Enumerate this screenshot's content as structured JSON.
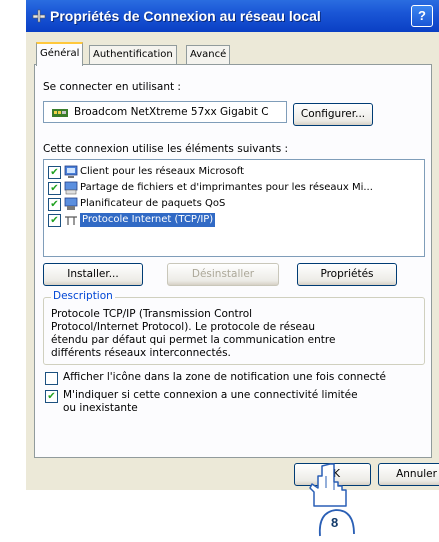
{
  "window": {
    "title": "Propriétés de Connexion au réseau local",
    "help_label": "?"
  },
  "tabs": [
    {
      "label": "Général"
    },
    {
      "label": "Authentification"
    },
    {
      "label": "Avancé"
    }
  ],
  "general": {
    "connect_using_label": "Se connecter en utilisant :",
    "adapter_name": "Broadcom NetXtreme 57xx Gigabit C",
    "configure_button": "Configurer...",
    "components_label": "Cette connexion utilise les éléments suivants :",
    "components": [
      {
        "label": "Client pour les réseaux Microsoft",
        "checked": true,
        "icon": "network-client-icon"
      },
      {
        "label": "Partage de fichiers et d'imprimantes pour les réseaux Mi...",
        "checked": true,
        "icon": "file-printer-sharing-icon"
      },
      {
        "label": "Planificateur de paquets QoS",
        "checked": true,
        "icon": "qos-scheduler-icon"
      },
      {
        "label": "Protocole Internet (TCP/IP)",
        "checked": true,
        "selected": true,
        "icon": "protocol-icon"
      }
    ],
    "install_button": "Installer...",
    "uninstall_button": "Désinstaller",
    "properties_button": "Propriétés",
    "description_legend": "Description",
    "description_text": "Protocole TCP/IP (Transmission Control Protocol/Internet Protocol). Le protocole de réseau étendu par défaut qui permet la communication entre différents réseaux interconnectés.",
    "show_icon_label": "Afficher l'icône dans la zone de notification une fois connecté",
    "show_icon_checked": false,
    "notify_label": "M'indiquer si cette connexion a une connectivité limitée ou inexistante",
    "notify_checked": true
  },
  "footer": {
    "ok_button": "OK",
    "cancel_button": "Annuler"
  },
  "annotation": {
    "step_number": "8"
  },
  "colors": {
    "titlebar": "#0a3fc4",
    "selection": "#316ac5",
    "legend": "#0046d5",
    "dialog_bg": "#ece9d8"
  }
}
